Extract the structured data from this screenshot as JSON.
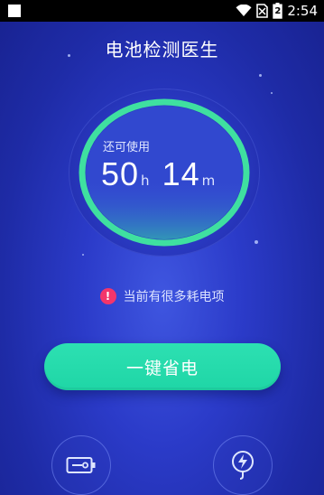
{
  "status_bar": {
    "time": "2:54",
    "battery_level": "2"
  },
  "app": {
    "title": "电池检测医生"
  },
  "gauge": {
    "label": "还可使用",
    "hours": "50",
    "hours_unit": "h",
    "minutes": "14",
    "minutes_unit": "m",
    "accent_color": "#3fe0a0"
  },
  "warning": {
    "icon": "!",
    "text": "当前有很多耗电项"
  },
  "actions": {
    "save_label": "一键省电",
    "save_color": "#23d9a9"
  },
  "bottom_nav": [
    {
      "icon": "battery-outline-icon"
    },
    {
      "icon": "charge-plug-icon"
    }
  ]
}
